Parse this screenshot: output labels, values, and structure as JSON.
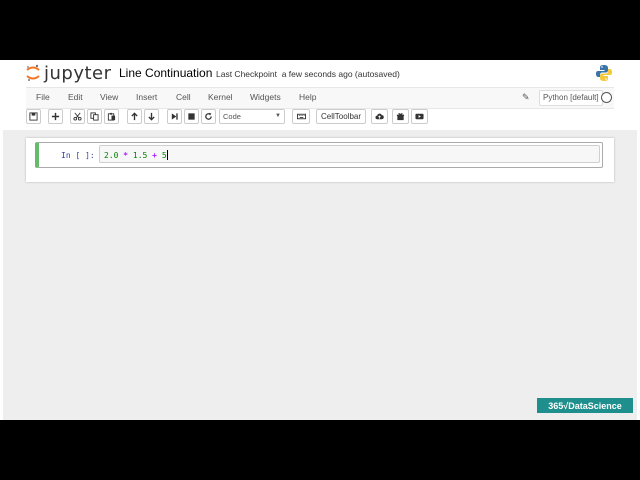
{
  "app": {
    "logo_text": "jupyter",
    "notebook_title": "Line Continuation",
    "checkpoint_label": "Last Checkpoint",
    "checkpoint_status": "a few seconds ago (autosaved)"
  },
  "menu": {
    "items": [
      "File",
      "Edit",
      "View",
      "Insert",
      "Cell",
      "Kernel",
      "Widgets",
      "Help"
    ]
  },
  "kernel": {
    "name": "Python [default]"
  },
  "toolbar": {
    "cell_type": "Code",
    "celltoolbar_label": "CellToolbar"
  },
  "cell": {
    "prompt": "In [ ]:",
    "code_tokens": [
      "2.0",
      " * ",
      "1.5",
      " + ",
      "5"
    ]
  },
  "watermark": {
    "text": "365√DataScience"
  },
  "colors": {
    "edit_mode_border": "#66bb6a",
    "prompt": "#303f9f",
    "operator": "#aa22ff",
    "number": "#008000",
    "watermark_bg": "#1e8f8c"
  }
}
